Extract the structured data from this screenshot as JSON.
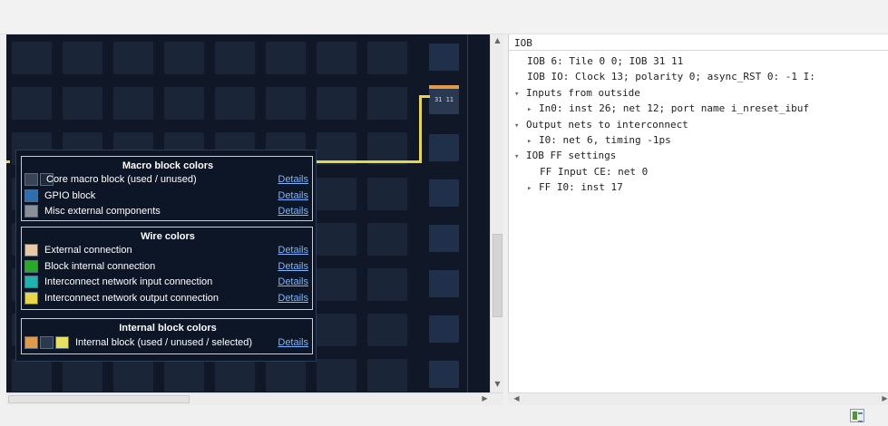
{
  "canvas": {
    "iob_tile_label": "31 11"
  },
  "legend": {
    "macro": {
      "title": "Macro block colors",
      "rows": [
        {
          "label": "Core macro block (used / unused)",
          "link": "Details",
          "colors": [
            "#3a4454",
            "#1e2838"
          ]
        },
        {
          "label": "GPIO block",
          "link": "Details",
          "colors": [
            "#2f6fb0"
          ]
        },
        {
          "label": "Misc external components",
          "link": "Details",
          "colors": [
            "#8a8f98"
          ]
        }
      ]
    },
    "wire": {
      "title": "Wire colors",
      "rows": [
        {
          "label": "External connection",
          "link": "Details",
          "colors": [
            "#e7c9a4"
          ]
        },
        {
          "label": "Block internal connection",
          "link": "Details",
          "colors": [
            "#2aa82a"
          ]
        },
        {
          "label": "Interconnect network input connection",
          "link": "Details",
          "colors": [
            "#1fb3b0"
          ]
        },
        {
          "label": "Interconnect network output connection",
          "link": "Details",
          "colors": [
            "#e8d64a"
          ]
        }
      ]
    },
    "internal": {
      "title": "Internal block colors",
      "rows": [
        {
          "label": "Internal block (used / unused / selected)",
          "link": "Details",
          "colors": [
            "#e09a4c",
            "#2a3850",
            "#e8e060"
          ]
        }
      ]
    }
  },
  "tree": {
    "header": "IOB",
    "lines": [
      {
        "text": "IOB 6: Tile 0 0; IOB 31 11",
        "toggle": ""
      },
      {
        "text": "IOB IO: Clock 13; polarity 0; async_RST 0: -1 I:",
        "toggle": ""
      },
      {
        "text": "Inputs from outside",
        "toggle": "▾"
      },
      {
        "text": "In0: inst 26; net 12; port name i_nreset_ibuf",
        "toggle": "▸"
      },
      {
        "text": "Output nets to interconnect",
        "toggle": "▾"
      },
      {
        "text": "I0: net 6, timing -1ps",
        "toggle": "▸"
      },
      {
        "text": "IOB FF settings",
        "toggle": "▾"
      },
      {
        "text": "FF Input CE: net 0",
        "toggle": ""
      },
      {
        "text": "FF I0: inst 17",
        "toggle": "▸"
      }
    ]
  },
  "colors": {
    "canvas_bg": "#101828",
    "wire_output": "#e8d64a",
    "link": "#7fb5ff"
  }
}
